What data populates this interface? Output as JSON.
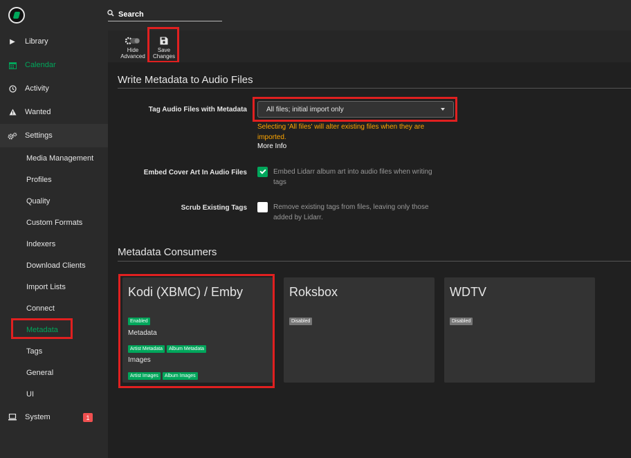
{
  "sidebar": {
    "items": [
      {
        "label": "Library",
        "icon": "play-icon"
      },
      {
        "label": "Calendar",
        "icon": "calendar-icon"
      },
      {
        "label": "Activity",
        "icon": "clock-icon"
      },
      {
        "label": "Wanted",
        "icon": "warning-icon"
      },
      {
        "label": "Settings",
        "icon": "cogs-icon"
      },
      {
        "label": "System",
        "icon": "laptop-icon",
        "badge": "1"
      }
    ],
    "settings_sub": [
      "Media Management",
      "Profiles",
      "Quality",
      "Custom Formats",
      "Indexers",
      "Download Clients",
      "Import Lists",
      "Connect",
      "Metadata",
      "Tags",
      "General",
      "UI"
    ]
  },
  "header": {
    "search_label": "Search"
  },
  "toolbar": {
    "hide_advanced_line1": "Hide",
    "hide_advanced_line2": "Advanced",
    "save_line1": "Save",
    "save_line2": "Changes"
  },
  "write_section": {
    "title": "Write Metadata to Audio Files",
    "tag_label": "Tag Audio Files with Metadata",
    "tag_value": "All files; initial import only",
    "warning": "Selecting 'All files' will alter existing files when they are imported.",
    "more_info": "More Info",
    "embed_label": "Embed Cover Art In Audio Files",
    "embed_help": "Embed Lidarr album art into audio files when writing tags",
    "embed_checked": true,
    "scrub_label": "Scrub Existing Tags",
    "scrub_help": "Remove existing tags from files, leaving only those added by Lidarr.",
    "scrub_checked": false
  },
  "consumers": {
    "title": "Metadata Consumers",
    "cards": [
      {
        "name": "Kodi (XBMC) / Emby",
        "status": "Enabled",
        "metadata_heading": "Metadata",
        "metadata_tags": [
          "Artist Metadata",
          "Album Metadata"
        ],
        "images_heading": "Images",
        "images_tags": [
          "Artist Images",
          "Album Images"
        ]
      },
      {
        "name": "Roksbox",
        "status": "Disabled"
      },
      {
        "name": "WDTV",
        "status": "Disabled"
      }
    ]
  },
  "colors": {
    "accent": "#00a65b",
    "warning": "#ffa500",
    "highlight": "#e02020",
    "badge": "#f05050"
  }
}
